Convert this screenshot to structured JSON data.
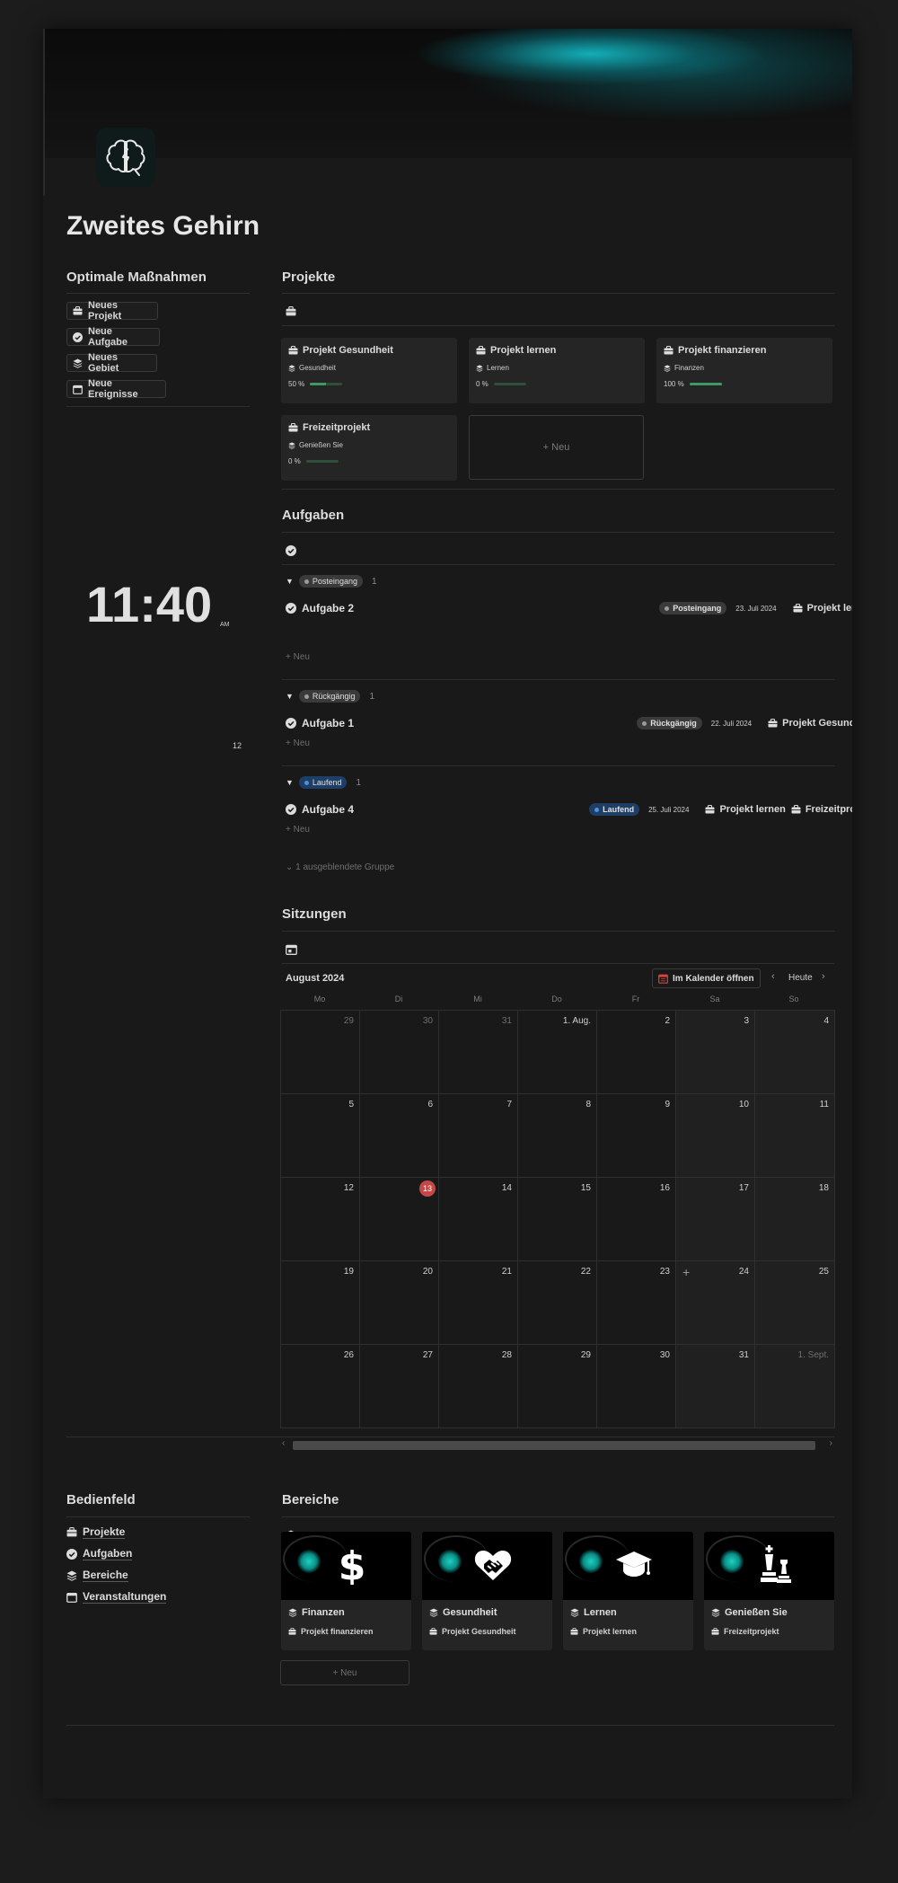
{
  "page": {
    "title": "Zweites Gehirn"
  },
  "sidebar": {
    "title": "Optimale Maßnahmen",
    "buttons": [
      {
        "label": "Neues Projekt",
        "icon": "briefcase-icon"
      },
      {
        "label": "Neue Aufgabe",
        "icon": "check-circle-icon"
      },
      {
        "label": "Neues Gebiet",
        "icon": "layers-icon"
      },
      {
        "label": "Neue Ereignisse",
        "icon": "calendar-icon"
      }
    ],
    "clock": {
      "time": "11:40",
      "ampm": "AM",
      "extra": "12"
    }
  },
  "projects": {
    "title": "Projekte",
    "cards": [
      {
        "name": "Projekt Gesundheit",
        "area": "Gesundheit",
        "progress_label": "50 %",
        "progress": 0.5
      },
      {
        "name": "Projekt lernen",
        "area": "Lernen",
        "progress_label": "0 %",
        "progress": 0
      },
      {
        "name": "Projekt finanzieren",
        "area": "Finanzen",
        "progress_label": "100 %",
        "progress": 1.0
      },
      {
        "name": "Freizeitprojekt",
        "area": "Genießen Sie",
        "progress_label": "0 %",
        "progress": 0
      }
    ],
    "new_label": "+ Neu"
  },
  "tasks": {
    "title": "Aufgaben",
    "groups": [
      {
        "status": "Posteingang",
        "count": "1",
        "color": "gray",
        "task": {
          "name": "Aufgabe 2",
          "status": "Posteingang",
          "date": "23. Juli 2024",
          "projects": [
            "Projekt lernen"
          ]
        }
      },
      {
        "status": "Rückgängig",
        "count": "1",
        "color": "gray",
        "task": {
          "name": "Aufgabe 1",
          "status": "Rückgängig",
          "date": "22. Juli 2024",
          "projects": [
            "Projekt Gesundheit"
          ]
        }
      },
      {
        "status": "Laufend",
        "count": "1",
        "color": "blue",
        "task": {
          "name": "Aufgabe 4",
          "status": "Laufend",
          "date": "25. Juli 2024",
          "projects": [
            "Projekt lernen",
            "Freizeitprojekt"
          ]
        }
      }
    ],
    "new_label": "+ Neu",
    "hidden_group": "⌄ 1 ausgeblendete Gruppe"
  },
  "sessions": {
    "title": "Sitzungen",
    "month": "August 2024",
    "open_calendar": "Im Kalender öffnen",
    "today_label": "Heute",
    "weekdays": [
      "Mo",
      "Di",
      "Mi",
      "Do",
      "Fr",
      "Sa",
      "So"
    ],
    "weeks": [
      [
        "29",
        "30",
        "31",
        "1. Aug.",
        "2",
        "3",
        "4"
      ],
      [
        "5",
        "6",
        "7",
        "8",
        "9",
        "10",
        "11"
      ],
      [
        "12",
        "13",
        "14",
        "15",
        "16",
        "17",
        "18"
      ],
      [
        "19",
        "20",
        "21",
        "22",
        "23",
        "24",
        "25"
      ],
      [
        "26",
        "27",
        "28",
        "29",
        "30",
        "31",
        "1. Sept."
      ]
    ],
    "today": "13"
  },
  "dashboard": {
    "title": "Bedienfeld",
    "links": [
      {
        "label": "Projekte",
        "icon": "briefcase-icon"
      },
      {
        "label": "Aufgaben",
        "icon": "check-circle-icon"
      },
      {
        "label": "Bereiche",
        "icon": "layers-icon"
      },
      {
        "label": "Veranstaltungen",
        "icon": "calendar-icon"
      }
    ]
  },
  "areas": {
    "title": "Bereiche",
    "cards": [
      {
        "name": "Finanzen",
        "project": "Projekt finanzieren",
        "image_icon": "dollar-icon"
      },
      {
        "name": "Gesundheit",
        "project": "Projekt Gesundheit",
        "image_icon": "heart-handshake-icon"
      },
      {
        "name": "Lernen",
        "project": "Projekt lernen",
        "image_icon": "graduation-cap-icon"
      },
      {
        "name": "Genießen Sie",
        "project": "Freizeitprojekt",
        "image_icon": "chess-icon"
      }
    ],
    "new_label": "+ Neu"
  },
  "colors": {
    "accent_teal": "#14b4be",
    "progress_green": "#3e9a64",
    "today_red": "#c54848",
    "status_blue": "#1f3e66"
  }
}
